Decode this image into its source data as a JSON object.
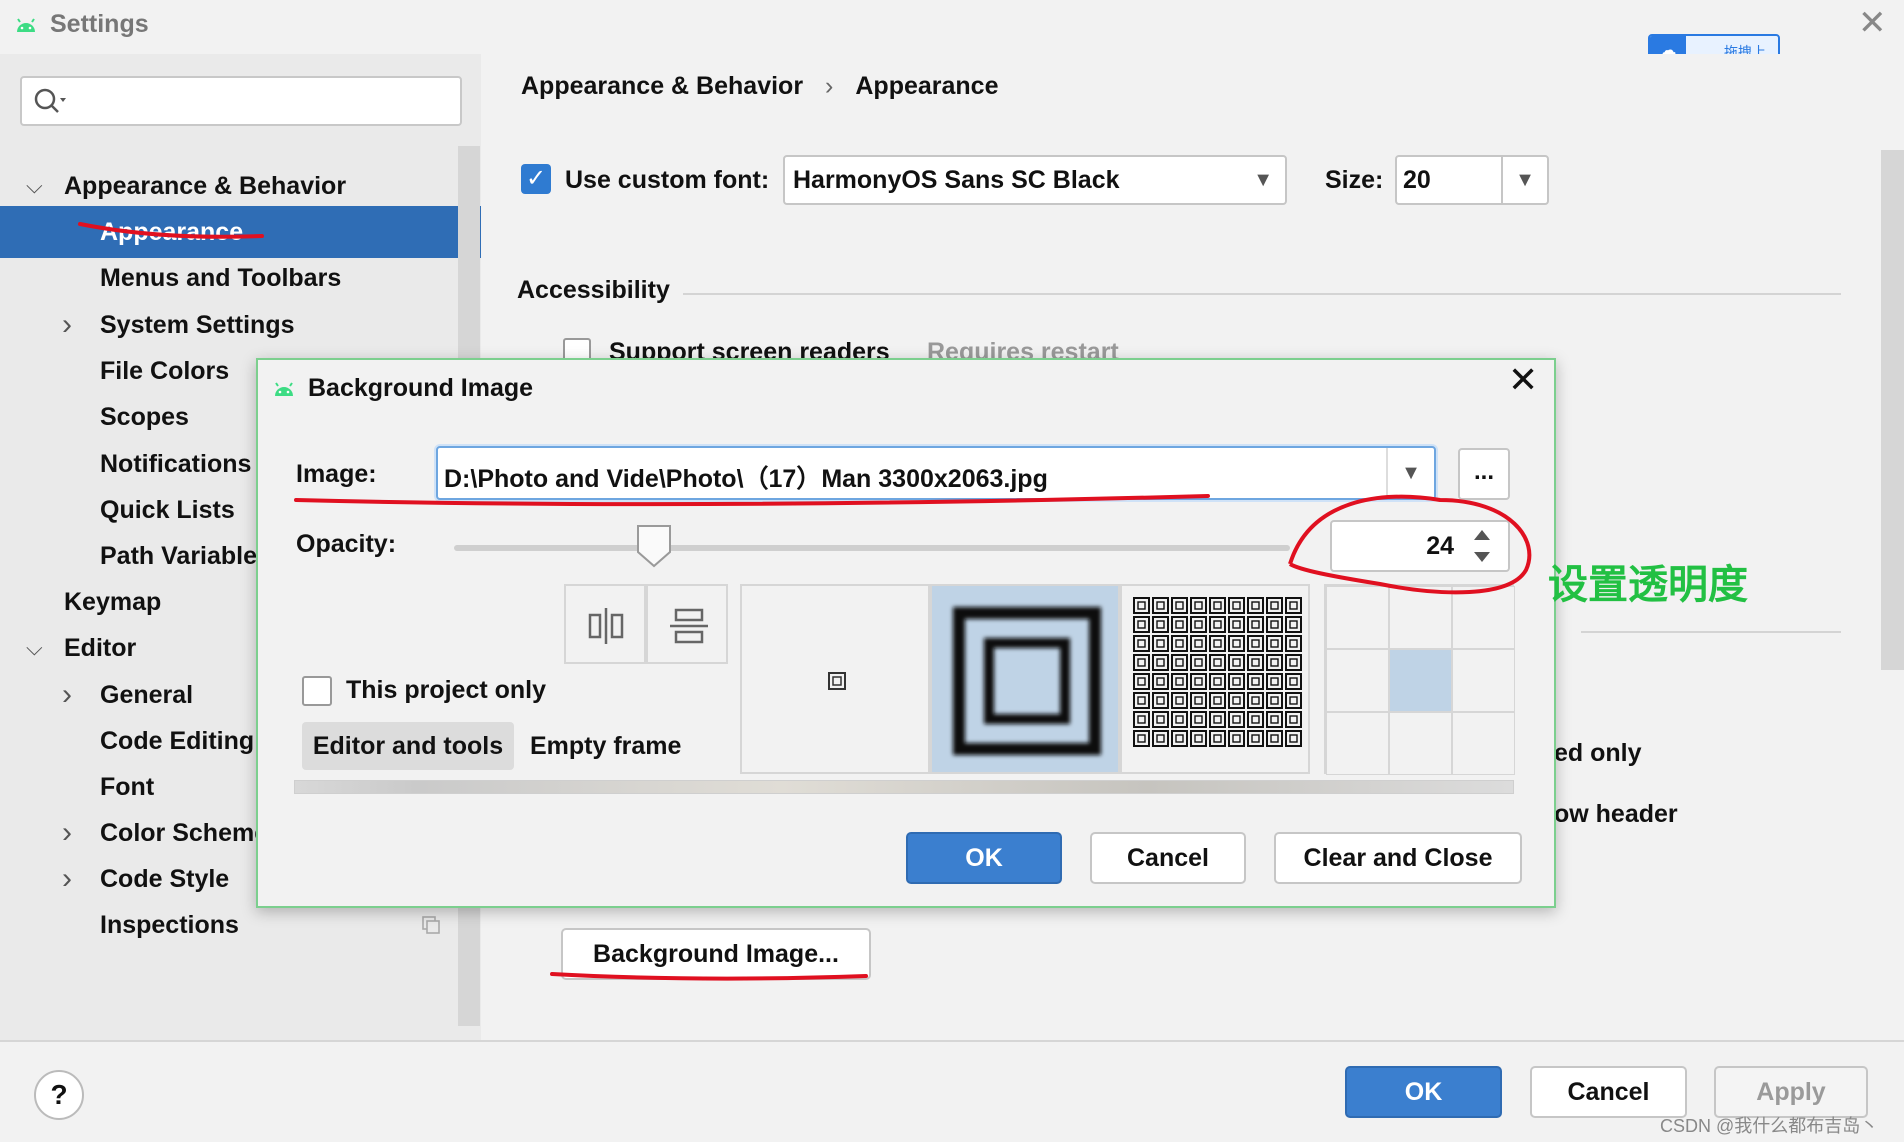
{
  "window": {
    "title": "Settings",
    "close_glyph": "✕"
  },
  "cloud_badge": {
    "label": "拖拽上传",
    "icon": "cloud-icon"
  },
  "sidebar": {
    "search": {
      "value": "",
      "placeholder": ""
    },
    "items": [
      {
        "label": "Appearance & Behavior",
        "level": 0,
        "expanded": true
      },
      {
        "label": "Appearance",
        "level": 1,
        "selected": true
      },
      {
        "label": "Menus and Toolbars",
        "level": 1
      },
      {
        "label": "System Settings",
        "level": 1,
        "collapsed": true
      },
      {
        "label": "File Colors",
        "level": 1
      },
      {
        "label": "Scopes",
        "level": 1
      },
      {
        "label": "Notifications",
        "level": 1
      },
      {
        "label": "Quick Lists",
        "level": 1
      },
      {
        "label": "Path Variables",
        "level": 1
      },
      {
        "label": "Keymap",
        "level": 0
      },
      {
        "label": "Editor",
        "level": 0,
        "expanded": true
      },
      {
        "label": "General",
        "level": 1,
        "collapsed": true
      },
      {
        "label": "Code Editing",
        "level": 1
      },
      {
        "label": "Font",
        "level": 1
      },
      {
        "label": "Color Scheme",
        "level": 1,
        "collapsed": true
      },
      {
        "label": "Code Style",
        "level": 1,
        "collapsed": true
      },
      {
        "label": "Inspections",
        "level": 1
      }
    ]
  },
  "main": {
    "breadcrumb": [
      "Appearance & Behavior",
      "Appearance"
    ],
    "breadcrumb_sep": "›",
    "custom_font": {
      "checked": true,
      "label": "Use custom font:",
      "value": "HarmonyOS Sans SC Black"
    },
    "size": {
      "label": "Size:",
      "value": "20"
    },
    "accessibility": {
      "title": "Accessibility",
      "screen_readers_label": "Support screen readers",
      "screen_readers_hint": "Requires restart"
    },
    "partial_text_1": "ed only",
    "partial_text_2": "ow header",
    "background_image_button": "Background Image..."
  },
  "dialog": {
    "title": "Background Image",
    "close_glyph": "✕",
    "image_label": "Image:",
    "image_value": "D:\\Photo and Vide\\Photo\\（17）Man 3300x2063.jpg",
    "browse_label": "...",
    "opacity_label": "Opacity:",
    "opacity_value": 24,
    "project_only_label": "This project only",
    "project_only_checked": false,
    "tabs": [
      "Editor and tools",
      "Empty frame"
    ],
    "fill_modes": [
      "plain",
      "scale",
      "tile"
    ],
    "selected_fill": "scale",
    "anchor_selected": "center",
    "buttons": {
      "ok": "OK",
      "cancel": "Cancel",
      "clear": "Clear and Close"
    }
  },
  "bottom": {
    "help": "?",
    "ok": "OK",
    "cancel": "Cancel",
    "apply": "Apply",
    "watermark": "CSDN @我什么都布吉岛丶"
  },
  "annotation": {
    "text": "设置透明度",
    "color": "#22c043"
  },
  "colors": {
    "accent": "#2f6db5",
    "primary_button": "#3b7fcf",
    "dialog_border": "#7ccf8e",
    "annotation_red": "#e01020"
  }
}
